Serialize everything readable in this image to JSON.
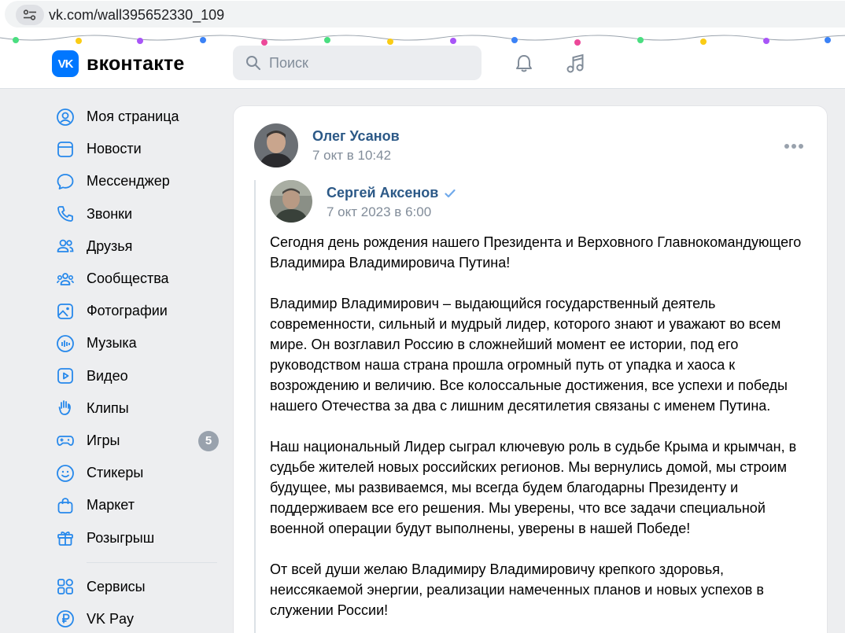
{
  "browser": {
    "url": "vk.com/wall395652330_109"
  },
  "header": {
    "logo_mark": "VK",
    "logo_text": "вконтакте",
    "search_placeholder": "Поиск",
    "icons": [
      "notifications-bell-icon",
      "music-note-icon"
    ]
  },
  "sidebar": {
    "items": [
      {
        "label": "Моя страница",
        "icon": "user-circle-icon"
      },
      {
        "label": "Новости",
        "icon": "newsfeed-icon"
      },
      {
        "label": "Мессенджер",
        "icon": "message-bubble-icon"
      },
      {
        "label": "Звонки",
        "icon": "phone-icon"
      },
      {
        "label": "Друзья",
        "icon": "friends-icon"
      },
      {
        "label": "Сообщества",
        "icon": "communities-icon"
      },
      {
        "label": "Фотографии",
        "icon": "photo-icon"
      },
      {
        "label": "Музыка",
        "icon": "music-bars-icon"
      },
      {
        "label": "Видео",
        "icon": "video-icon"
      },
      {
        "label": "Клипы",
        "icon": "clips-icon"
      },
      {
        "label": "Игры",
        "icon": "gamepad-icon",
        "badge": "5"
      },
      {
        "label": "Стикеры",
        "icon": "smile-icon"
      },
      {
        "label": "Маркет",
        "icon": "shopping-bag-icon"
      },
      {
        "label": "Розыгрыш",
        "icon": "gift-icon"
      }
    ],
    "extra_items": [
      {
        "label": "Сервисы",
        "icon": "services-grid-icon"
      },
      {
        "label": "VK Pay",
        "icon": "ruble-icon"
      }
    ]
  },
  "post": {
    "author": "Олег Усанов",
    "date": "7 окт в 10:42",
    "repost": {
      "author": "Сергей Аксенов",
      "date": "7 окт 2023 в 6:00",
      "paragraphs": [
        "Сегодня день рождения нашего Президента и Верховного Главнокомандующего Владимира Владимировича Путина!",
        "Владимир Владимирович – выдающийся государственный деятель современности, сильный и мудрый лидер, которого знают и уважают во всем мире. Он возглавил Россию в сложнейший момент ее истории, под его руководством наша страна прошла огромный путь от упадка и хаоса к возрождению и величию. Все колоссальные достижения, все успехи и победы нашего Отечества за два с лишним десятилетия связаны с именем Путина.",
        "Наш национальный Лидер сыграл ключевую роль в судьбе Крыма и крымчан, в судьбе жителей новых российских регионов. Мы вернулись домой, мы строим будущее, мы развиваемся, мы всегда будем благодарны Президенту и поддерживаем все его решения. Мы уверены, что все задачи специальной военной операции будут выполнены, уверены в нашей Победе!",
        "От всей души желаю Владимиру Владимировичу крепкого здоровья, неиссякаемой энергии, реализации намеченных планов и новых успехов в служении России!"
      ]
    }
  },
  "colors": {
    "vk_blue": "#0077ff",
    "link": "#2c5987",
    "muted": "#818c99",
    "page_bg": "#edeef0"
  }
}
